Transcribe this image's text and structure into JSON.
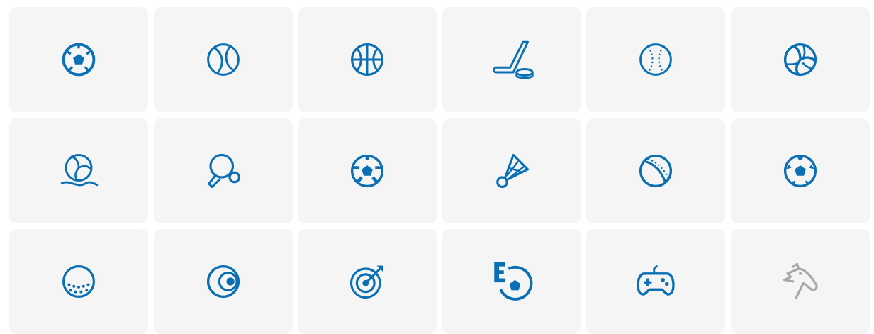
{
  "colors": {
    "icon": "#0a6fb5",
    "muted": "#a8a8a8",
    "tile": "#f5f5f5"
  },
  "icons": [
    "soccer-ball-icon",
    "tennis-ball-icon",
    "basketball-icon",
    "hockey-stick-puck-icon",
    "baseball-icon",
    "volleyball-icon",
    "beach-volleyball-icon",
    "ping-pong-icon",
    "football-ball-icon",
    "badminton-shuttlecock-icon",
    "cricket-ball-icon",
    "soccer-ball-alt-icon",
    "golf-ball-icon",
    "bowling-ball-icon",
    "archery-target-icon",
    "esports-soccer-icon",
    "game-controller-icon",
    "horse-icon"
  ],
  "muted_icons": [
    "horse-icon"
  ]
}
